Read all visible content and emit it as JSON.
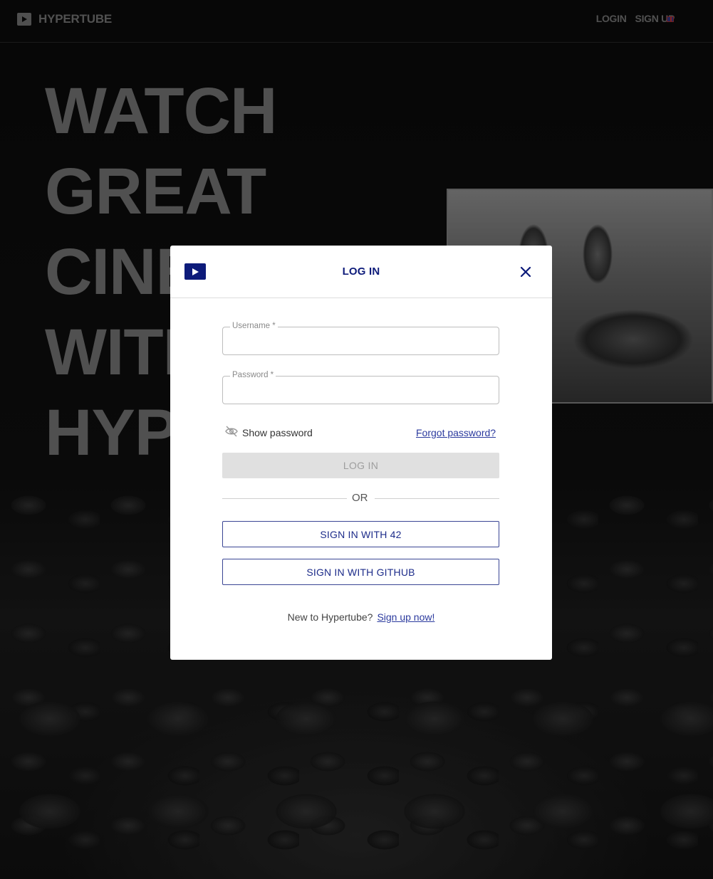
{
  "navbar": {
    "brand": "HYPERTUBE",
    "login_label": "LOGIN",
    "signup_label": "SIGN UP"
  },
  "hero": {
    "lines": [
      "WATCH",
      "GREAT",
      "CINEMA",
      "WITH",
      "HYPERTUBE"
    ]
  },
  "modal": {
    "title": "LOG IN",
    "username_label": "Username *",
    "password_label": "Password *",
    "show_password": "Show password",
    "forgot_password": "Forgot password?",
    "login_button": "LOG IN",
    "or_text": "OR",
    "sign_in_42": "SIGN IN WITH 42",
    "sign_in_github": "SIGN IN WITH GITHUB",
    "new_user_text": "New to Hypertube?",
    "signup_link": "Sign up now!"
  },
  "colors": {
    "primary": "#0d1b7a",
    "link": "#2b3a9e",
    "disabled_bg": "#e0e0e0",
    "nav_text": "#7d7d7d"
  },
  "icons": {
    "brand": "play-icon",
    "close": "close-icon",
    "visibility": "eye-off-icon",
    "language": "uk-flag-icon"
  }
}
